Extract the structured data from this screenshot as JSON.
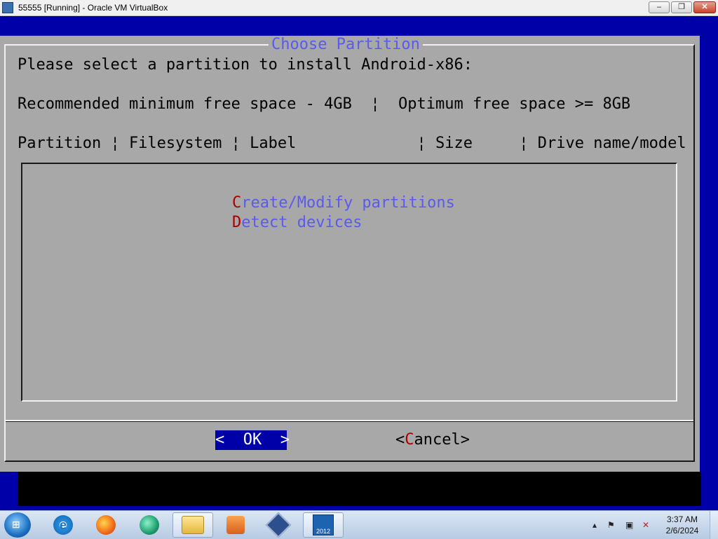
{
  "window": {
    "title": "55555 [Running] - Oracle VM VirtualBox",
    "minimize": "–",
    "maximize": "❐",
    "close": "✕"
  },
  "dialog": {
    "title": "Choose Partition",
    "prompt": "Please select a partition to install Android-x86:",
    "space_info": "Recommended minimum free space - 4GB  ¦  Optimum free space >= 8GB",
    "columns": "Partition ¦ Filesystem ¦ Label             ¦ Size     ¦ Drive name/model",
    "items": [
      {
        "hotkey": "C",
        "rest": "reate/Modify partitions"
      },
      {
        "hotkey": "D",
        "rest": "etect devices"
      }
    ],
    "ok_label": "<  OK  >",
    "cancel": {
      "open": "<",
      "hotkey": "C",
      "rest": "ancel",
      "close": ">"
    }
  },
  "taskbar": {
    "start_icon": "windows-logo",
    "pinned": [
      {
        "name": "internet-explorer-icon",
        "glyph": "e"
      },
      {
        "name": "firefox-icon",
        "glyph": ""
      },
      {
        "name": "chat-bubble-icon",
        "glyph": ""
      },
      {
        "name": "file-explorer-icon",
        "glyph": ""
      },
      {
        "name": "media-player-icon",
        "glyph": ""
      },
      {
        "name": "virtualbox-icon",
        "glyph": ""
      },
      {
        "name": "windows-2012-icon",
        "glyph": "2012"
      }
    ],
    "tray": {
      "arrow": "▴",
      "flag": "⚑",
      "network": "▣",
      "volume": "✕"
    },
    "time": "3:37 AM",
    "date": "2/6/2024"
  }
}
